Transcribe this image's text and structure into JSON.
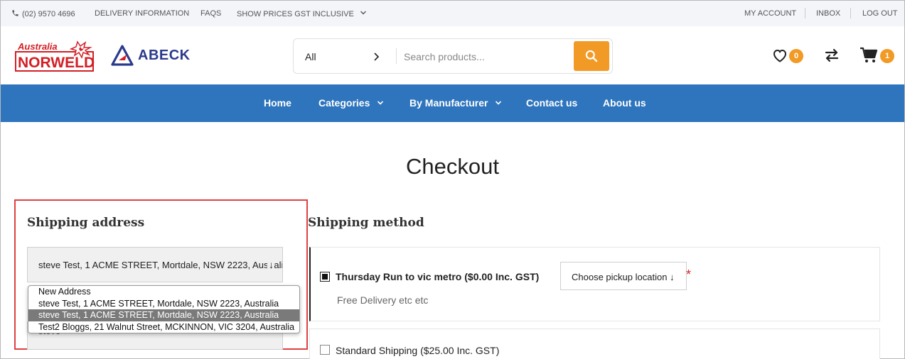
{
  "topbar": {
    "phone": "(02) 9570 4696",
    "delivery": "DELIVERY INFORMATION",
    "faqs": "FAQS",
    "gst": "SHOW PRICES GST INCLUSIVE",
    "account": "MY ACCOUNT",
    "inbox": "INBOX",
    "logout": "LOG OUT"
  },
  "logos": {
    "norweld_top": "Australia",
    "norweld_main": "NORWELD",
    "abeck": "ABECK"
  },
  "search": {
    "category": "All",
    "placeholder": "Search products..."
  },
  "header_icons": {
    "wishlist_count": "0",
    "cart_count": "1"
  },
  "nav": {
    "home": "Home",
    "categories": "Categories",
    "manufacturer": "By Manufacturer",
    "contact": "Contact us",
    "about": "About us"
  },
  "page": {
    "title": "Checkout"
  },
  "shipping_address": {
    "title": "Shipping address",
    "selected": "steve Test, 1 ACME STREET, Mortdale, NSW 2223, Australia",
    "below_value": "steve",
    "options": [
      "New Address",
      "steve Test, 1 ACME STREET, Mortdale, NSW 2223, Australia",
      "steve Test, 1 ACME STREET, Mortdale, NSW 2223, Australia",
      "Test2 Bloggs, 21 Walnut Street, MCKINNON, VIC 3204, Australia"
    ],
    "highlighted_index": 2
  },
  "shipping_method": {
    "title": "Shipping method",
    "option1_label": "Thursday Run to vic metro ($0.00 Inc. GST)",
    "option1_desc": "Free Delivery etc etc",
    "pickup_label": "Choose pickup location",
    "required_mark": "*",
    "option2_label": "Standard Shipping ($25.00 Inc. GST)"
  },
  "colors": {
    "nav_bg": "#2f75bd",
    "accent": "#f29a26",
    "highlight_border": "#e04040"
  }
}
